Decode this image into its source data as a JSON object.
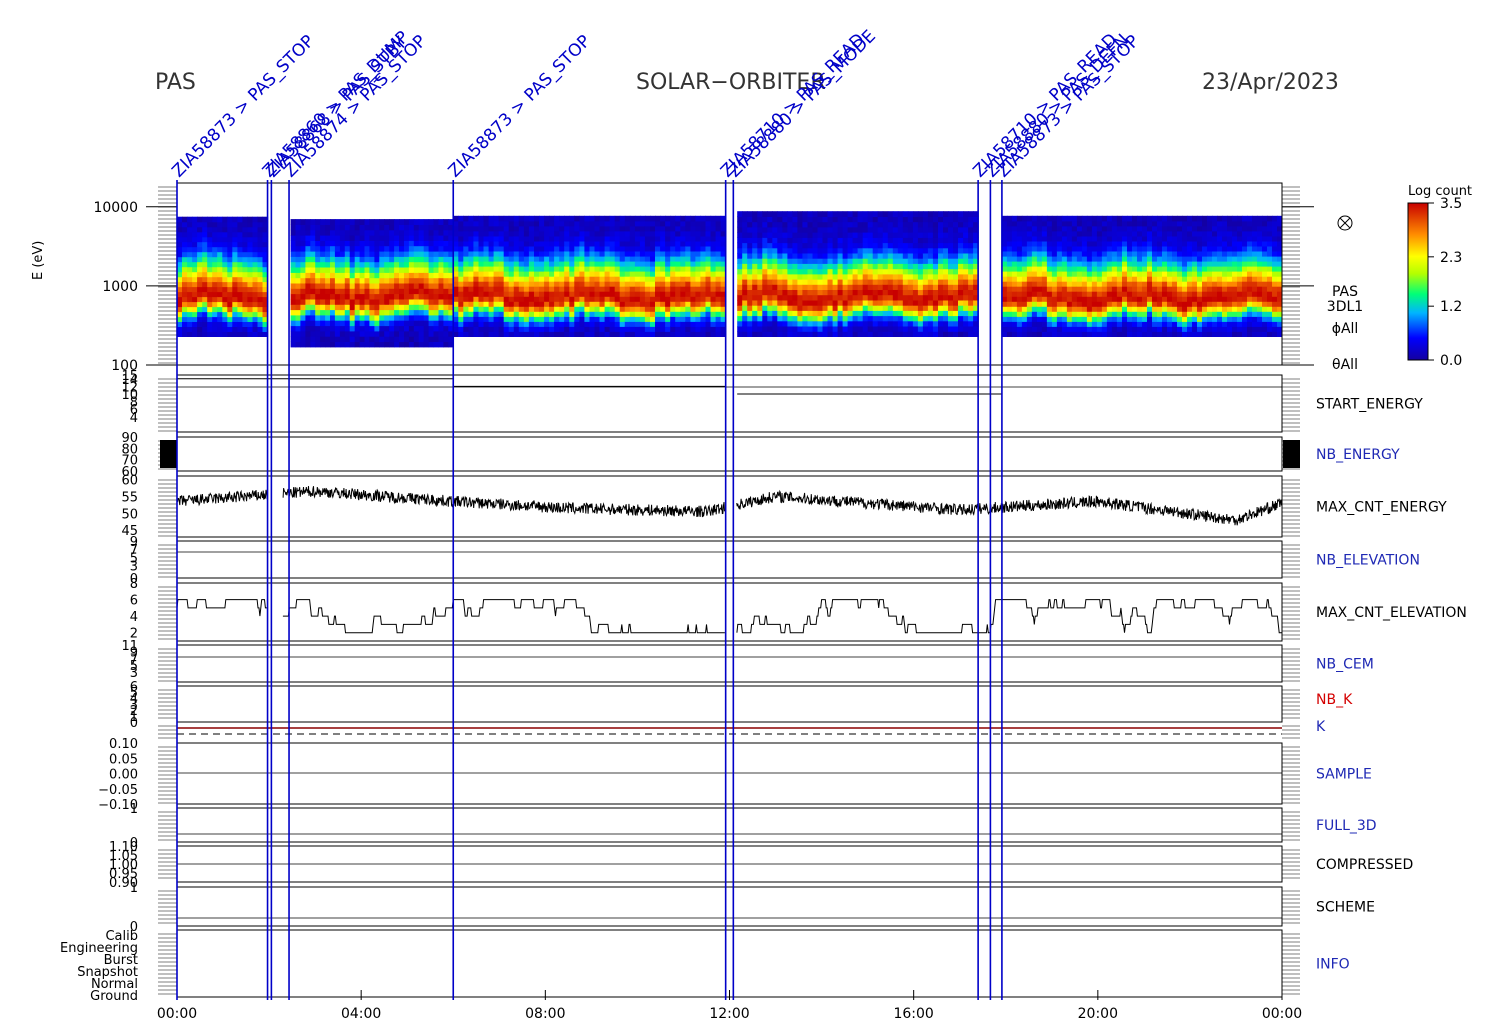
{
  "header": {
    "left": "PAS",
    "center": "SOLAR−ORBITER",
    "right": "23/Apr/2023"
  },
  "colors": {
    "mode_line": "#0000c8",
    "red_label": "#d40000",
    "blue_label": "#1e28b4",
    "black": "#000000"
  },
  "events": [
    {
      "label": "ZIA58873 > PAS_STOP",
      "time": "00:00"
    },
    {
      "label": "ZIA58860 > PAS_DUMP",
      "time": "01:58"
    },
    {
      "label": "ZIA58868 > PAS_STBY",
      "time": "02:03"
    },
    {
      "label": "ZIA58874 > PAS_STOP",
      "time": "02:26"
    },
    {
      "label": "ZIA58873 > PAS_STOP",
      "time": "06:00"
    },
    {
      "label": "ZIA58710 > PAS_READ",
      "time": "11:55"
    },
    {
      "label": "ZIA58880 > PAS_MODE",
      "time": "12:05"
    },
    {
      "label": "ZIA58710 > PAS_READ",
      "time": "17:24"
    },
    {
      "label": "ZIA58880 > PAS_DEFN",
      "time": "17:40"
    },
    {
      "label": "ZIA58873 > PAS_STOP",
      "time": "17:55"
    }
  ],
  "chart_data": {
    "type": "multi-panel time series",
    "x_range": [
      "00:00",
      "00:00"
    ],
    "x_ticks": [
      "00:00",
      "04:00",
      "08:00",
      "12:00",
      "16:00",
      "20:00",
      "00:00"
    ],
    "panels": [
      {
        "name": "spectrogram",
        "type": "heatmap",
        "ylabel": "E (eV)",
        "yscale": "log",
        "ylim": [
          100,
          20000
        ],
        "yticks": [
          "10000",
          "1000",
          "100"
        ],
        "side_labels": [
          "PAS",
          "3DL1",
          "ϕAll",
          "θAll"
        ],
        "colorbar": {
          "title": "Log count",
          "range": [
            0.0,
            3.5
          ],
          "ticks": [
            "3.5",
            "2.3",
            "1.2",
            "0.0"
          ]
        },
        "peak_energy_ev": 700,
        "segments": [
          {
            "from": "00:00",
            "to": "01:58",
            "emin": 230,
            "emax": 7500
          },
          {
            "from": "02:28",
            "to": "06:00",
            "emin": 170,
            "emax": 7000
          },
          {
            "from": "06:00",
            "to": "11:55",
            "emin": 230,
            "emax": 7700
          },
          {
            "from": "12:10",
            "to": "17:24",
            "emin": 230,
            "emax": 8800
          },
          {
            "from": "17:55",
            "to": "24:00",
            "emin": 230,
            "emax": 7700
          }
        ]
      },
      {
        "name": "START_ENERGY",
        "label_color": "black",
        "ylim": [
          0,
          15
        ],
        "yticks": [
          "15",
          "14",
          "12",
          "10",
          "8",
          "6",
          "4"
        ],
        "steps": [
          {
            "from": "00:00",
            "to": "06:00",
            "value": 14.0
          },
          {
            "from": "06:00",
            "to": "11:55",
            "value": 12.0
          },
          {
            "from": "12:10",
            "to": "17:55",
            "value": 10.0
          }
        ]
      },
      {
        "name": "NB_ENERGY",
        "label_color": "blue",
        "ylim": [
          60,
          90
        ],
        "yticks": [
          "90",
          "80",
          "70",
          "60"
        ]
      },
      {
        "name": "MAX_CNT_ENERGY",
        "label_color": "black",
        "ylim": [
          43,
          61
        ],
        "yticks": [
          "60",
          "55",
          "50",
          "45"
        ],
        "baseline": 53.5,
        "trend": [
          {
            "t": 0,
            "v": 53.5
          },
          {
            "t": 3,
            "v": 56.5
          },
          {
            "t": 6,
            "v": 53.5
          },
          {
            "t": 8.5,
            "v": 51.5
          },
          {
            "t": 11.5,
            "v": 50.5
          },
          {
            "t": 13,
            "v": 55
          },
          {
            "t": 17,
            "v": 51
          },
          {
            "t": 20,
            "v": 53.5
          },
          {
            "t": 23,
            "v": 48
          },
          {
            "t": 24,
            "v": 53
          }
        ]
      },
      {
        "name": "NB_ELEVATION",
        "label_color": "blue",
        "ylim": [
          0,
          9
        ],
        "yticks": [
          "9",
          "7",
          "5",
          "3",
          "0"
        ]
      },
      {
        "name": "MAX_CNT_ELEVATION",
        "label_color": "black",
        "ylim": [
          1,
          8
        ],
        "yticks": [
          "8",
          "6",
          "4",
          "2"
        ],
        "levels": [
          2,
          3,
          4,
          5,
          6
        ]
      },
      {
        "name": "NB_CEM",
        "label_color": "blue",
        "ylim": [
          0,
          11
        ],
        "yticks": [
          "11",
          "9",
          "7",
          "5",
          "3"
        ]
      },
      {
        "name": "NB_K",
        "label_color": "red",
        "ylim": [
          0,
          6
        ],
        "yticks": [
          "6",
          "5",
          "4",
          "3",
          "2",
          "1",
          "0"
        ],
        "line_value": 1
      },
      {
        "name": "K",
        "label_color": "blue",
        "ylim": [
          0,
          6
        ],
        "line_value": 0
      },
      {
        "name": "SAMPLE",
        "label_color": "blue",
        "ylim": [
          -0.1,
          0.1
        ],
        "yticks": [
          "0.10",
          "0.05",
          "0.00",
          "−0.05",
          "−0.10"
        ]
      },
      {
        "name": "FULL_3D",
        "label_color": "blue",
        "ylim": [
          0,
          1
        ],
        "yticks": [
          "1",
          "0"
        ]
      },
      {
        "name": "COMPRESSED",
        "label_color": "black",
        "ylim": [
          0.9,
          1.1
        ],
        "yticks": [
          "1.10",
          "1.05",
          "1.00",
          "0.95",
          "0.90"
        ]
      },
      {
        "name": "SCHEME",
        "label_color": "black",
        "ylim": [
          0,
          1
        ],
        "yticks": [
          "1",
          "0"
        ]
      },
      {
        "name": "INFO",
        "label_color": "blue",
        "yticks": [
          "Calib",
          "Engineering",
          "Burst",
          "Snapshot",
          "Normal",
          "Ground"
        ]
      }
    ]
  }
}
